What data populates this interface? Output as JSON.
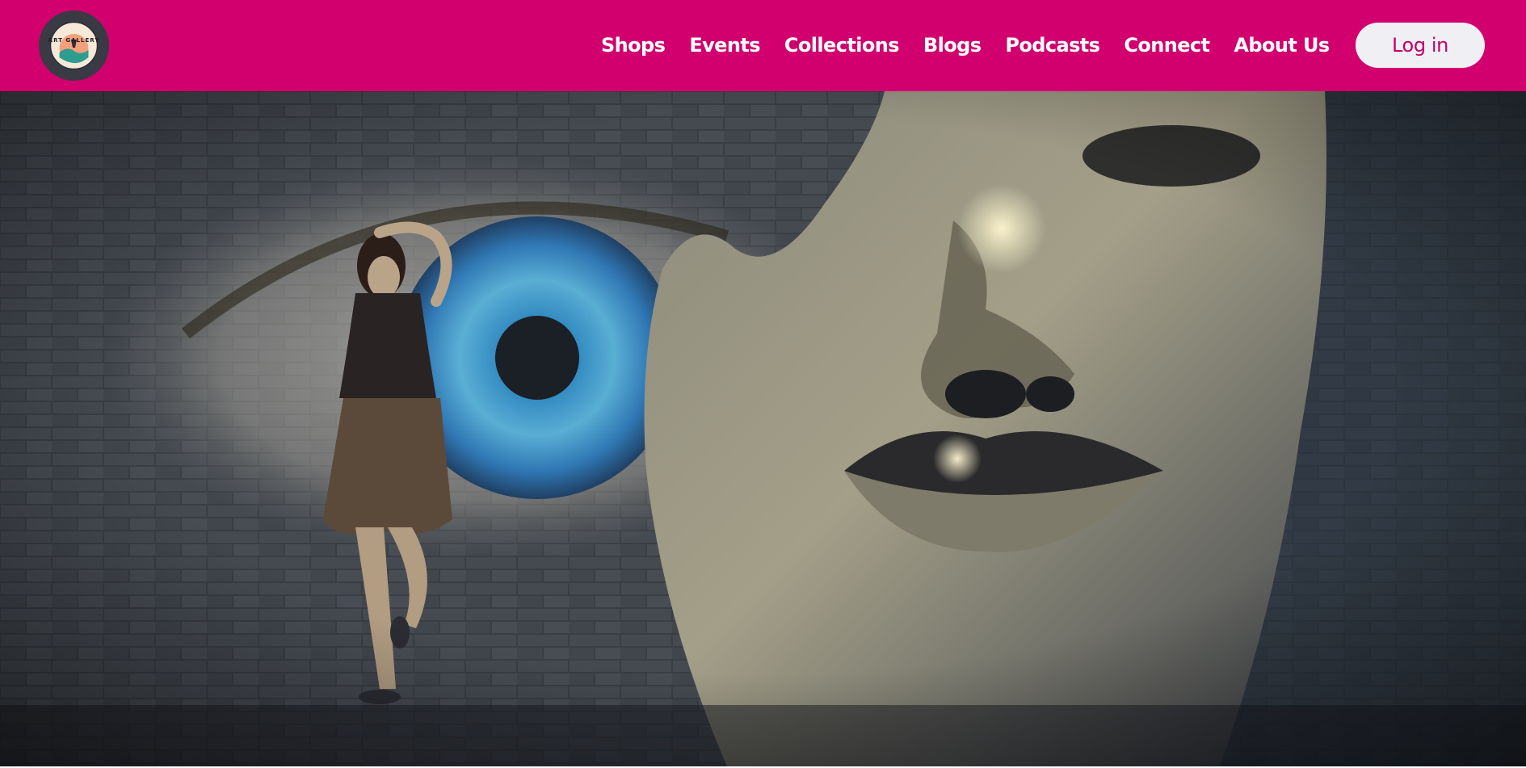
{
  "header": {
    "background_color": "#d1006e",
    "logo": {
      "name": "art-gallery-logo",
      "text": "ART GALLERY"
    },
    "nav": [
      {
        "label": "Shops",
        "id": "shops"
      },
      {
        "label": "Events",
        "id": "events"
      },
      {
        "label": "Collections",
        "id": "collections"
      },
      {
        "label": "Blogs",
        "id": "blogs"
      },
      {
        "label": "Podcasts",
        "id": "podcasts"
      },
      {
        "label": "Connect",
        "id": "connect"
      },
      {
        "label": "About Us",
        "id": "about-us"
      }
    ],
    "login_label": "Log in"
  },
  "hero": {
    "image": "surreal-brick-wall-artwork",
    "elements": [
      "giant-blue-eye-mural",
      "woman-leaning-on-wall",
      "stone-face-sculpture"
    ]
  }
}
